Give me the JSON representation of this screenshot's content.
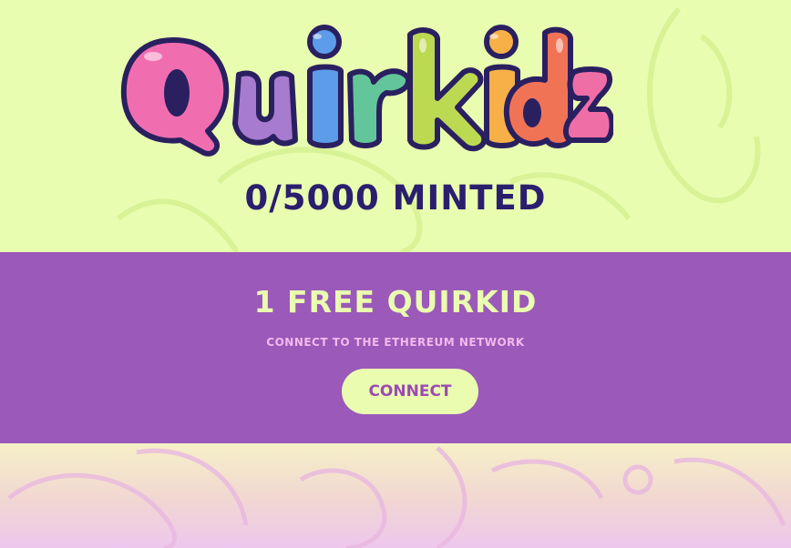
{
  "header": {
    "logo_text": "Quirkidz",
    "minted_text": "0/5000 MINTED"
  },
  "mint_panel": {
    "title": "1 FREE QUIRKID",
    "subtitle": "CONNECT TO THE ETHEREUM NETWORK",
    "connect_label": "CONNECT"
  },
  "colors": {
    "top_background": "#e9fdb0",
    "band_background": "#9b59b9",
    "button_background": "#eafcb0",
    "button_text": "#9b4bb2",
    "minted_text": "#2a1e6e",
    "title_text": "#eafcb0",
    "subtitle_text": "#f5b8ec"
  }
}
